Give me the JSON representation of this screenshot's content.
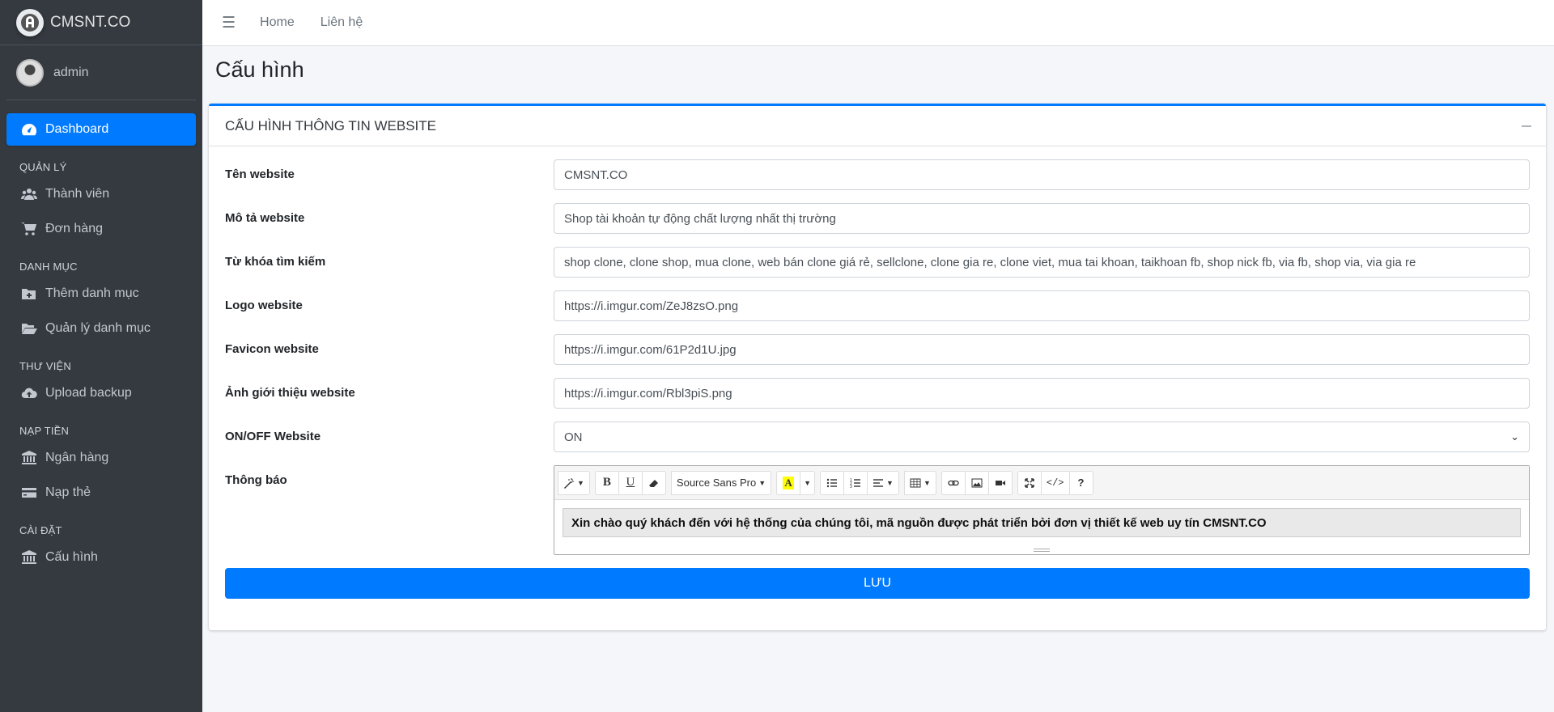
{
  "brand": {
    "name": "CMSNT.CO",
    "logo_icon": "brand-logo-icon"
  },
  "user": {
    "name": "admin"
  },
  "sidebar": {
    "dashboard": "Dashboard",
    "sections": [
      {
        "header": "QUẢN LÝ",
        "items": [
          {
            "label": "Thành viên",
            "icon": "users-icon"
          },
          {
            "label": "Đơn hàng",
            "icon": "cart-icon"
          }
        ]
      },
      {
        "header": "DANH MỤC",
        "items": [
          {
            "label": "Thêm danh mục",
            "icon": "folder-plus-icon"
          },
          {
            "label": "Quản lý danh mục",
            "icon": "folder-open-icon"
          }
        ]
      },
      {
        "header": "THƯ VIỆN",
        "items": [
          {
            "label": "Upload backup",
            "icon": "cloud-upload-icon"
          }
        ]
      },
      {
        "header": "NẠP TIỀN",
        "items": [
          {
            "label": "Ngân hàng",
            "icon": "bank-icon"
          },
          {
            "label": "Nạp thẻ",
            "icon": "credit-card-icon"
          }
        ]
      },
      {
        "header": "CÀI ĐẶT",
        "items": [
          {
            "label": "Cấu hình",
            "icon": "bank-icon"
          }
        ]
      }
    ]
  },
  "topbar": {
    "menu_icon": "☰",
    "links": [
      "Home",
      "Liên hệ"
    ]
  },
  "page": {
    "title": "Cấu hình"
  },
  "card": {
    "title": "CẤU HÌNH THÔNG TIN WEBSITE",
    "fields": [
      {
        "label": "Tên website",
        "value": "CMSNT.CO"
      },
      {
        "label": "Mô tả website",
        "value": "Shop tài khoản tự động chất lượng nhất thị trường"
      },
      {
        "label": "Từ khóa tìm kiếm",
        "value": "shop clone, clone shop, mua clone, web bán clone giá rẻ, sellclone, clone gia re, clone viet, mua tai khoan, taikhoan fb, shop nick fb, via fb, shop via, via gia re"
      },
      {
        "label": "Logo website",
        "value": "https://i.imgur.com/ZeJ8zsO.png"
      },
      {
        "label": "Favicon website",
        "value": "https://i.imgur.com/61P2d1U.jpg"
      },
      {
        "label": "Ảnh giới thiệu website",
        "value": "https://i.imgur.com/Rbl3piS.png"
      }
    ],
    "status": {
      "label": "ON/OFF Website",
      "selected": "ON"
    },
    "notice": {
      "label": "Thông báo",
      "font": "Source Sans Pro",
      "content": "Xin chào quý khách đến với hệ thống của chúng tôi, mã nguồn được phát triển bởi đơn vị thiết kế web uy tín CMSNT.CO"
    },
    "save_label": "LƯU"
  },
  "colors": {
    "primary": "#007bff",
    "sidebar": "#343a40",
    "background": "#f4f6f9"
  }
}
